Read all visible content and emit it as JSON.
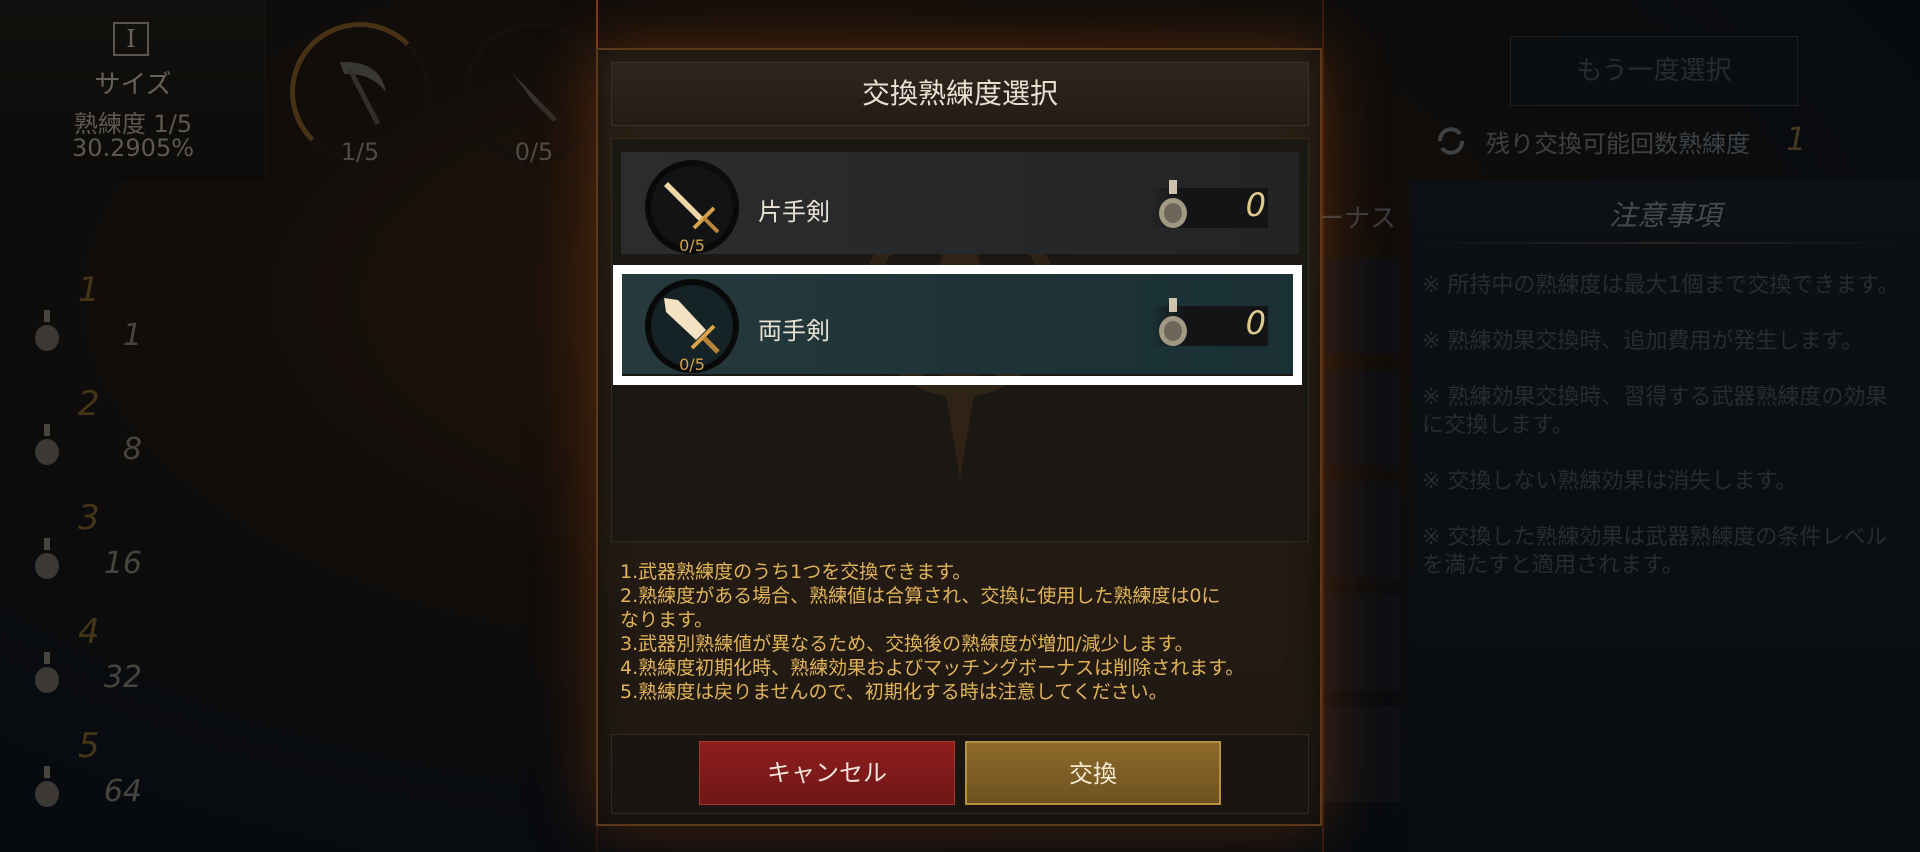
{
  "background": {
    "size_card": {
      "icon": "I",
      "name": "サイズ",
      "level": "熟練度 1/5",
      "percent": "30.2905%"
    },
    "top_weapons": [
      {
        "icon": "scythe-icon",
        "count": "1/5"
      },
      {
        "icon": "dagger-icon",
        "count": "0/5"
      }
    ],
    "levels": [
      {
        "level": "1",
        "value": "1"
      },
      {
        "level": "2",
        "value": "8"
      },
      {
        "level": "3",
        "value": "16"
      },
      {
        "level": "4",
        "value": "32"
      },
      {
        "level": "5",
        "value": "64"
      }
    ],
    "reselect_button": "もう一度選択",
    "remaining_label": "残り交換可能回数熟練度",
    "remaining_count": "1",
    "bonus_tab": "ーナス",
    "notes": {
      "title": "注意事項",
      "items": [
        "※  所持中の熟練度は最大1個まで交換できます。",
        "※  熟練効果交換時、追加費用が発生します。",
        "※  熟練効果交換時、習得する武器熟練度の効果に交換します。",
        "※  交換しない熟練効果は消失します。",
        "※  交換した熟練効果は武器熟練度の条件レベルを満たすと適用されます。"
      ]
    }
  },
  "modal": {
    "title": "交換熟練度選択",
    "weapons": [
      {
        "name": "片手剣",
        "count": "0/5",
        "value": "0",
        "icon": "one-handed-sword-icon",
        "selected": false
      },
      {
        "name": "両手剣",
        "count": "0/5",
        "value": "0",
        "icon": "two-handed-sword-icon",
        "selected": true
      }
    ],
    "info": [
      "1.武器熟練度のうち1つを交換できます。",
      "2.熟練度がある場合、熟練値は合算され、交換に使用した熟練度は0に",
      "なります。",
      "3.武器別熟練値が異なるため、交換後の熟練度が増加/減少します。",
      "4.熟練度初期化時、熟練効果およびマッチングボーナスは削除されます。",
      "5.熟練度は戻りませんので、初期化する時は注意してください。"
    ],
    "cancel_label": "キャンセル",
    "confirm_label": "交換"
  },
  "colors": {
    "accent_gold": "#e1b458",
    "cancel_red": "#8e1e1e",
    "confirm_gold": "#8d6a2a",
    "selection_frame": "#ffffff"
  }
}
